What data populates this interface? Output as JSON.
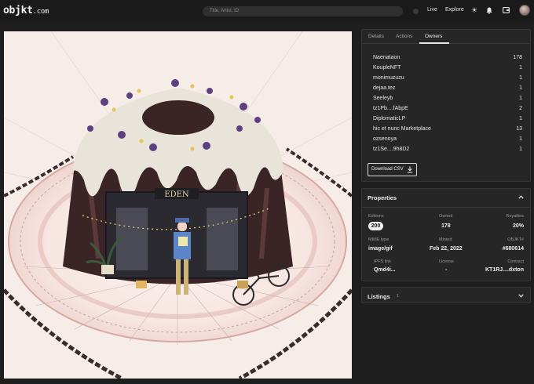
{
  "header": {
    "logo_main": "objkt",
    "logo_suffix": ".com",
    "search_placeholder": "Title, Artist, ID",
    "nav_live": "Live",
    "nav_explore": "Explore",
    "icons": [
      "sun-icon",
      "bell-icon",
      "wallet-icon",
      "avatar"
    ]
  },
  "tabs": [
    "Details",
    "Actions",
    "Owners"
  ],
  "active_tab": "Owners",
  "owners": [
    {
      "name": "Naenataon",
      "count": "178"
    },
    {
      "name": "KoupleNFT",
      "count": "1"
    },
    {
      "name": "monimuzuzu",
      "count": "1"
    },
    {
      "name": "dejaa.tez",
      "count": "1"
    },
    {
      "name": "Seeleyb",
      "count": "1"
    },
    {
      "name": "tz1Pb....fAbpE",
      "count": "2"
    },
    {
      "name": "DiplomaticLP",
      "count": "1"
    },
    {
      "name": "hic et nunc Marketplace",
      "count": "13"
    },
    {
      "name": "ozsenoya",
      "count": "1"
    },
    {
      "name": "tz1Se....9h8D2",
      "count": "1"
    }
  ],
  "download_csv": "Download CSV",
  "properties": {
    "title": "Properties",
    "editions_label": "Editions",
    "editions_value": "200",
    "owned_label": "Owned",
    "owned_value": "178",
    "royalties_label": "Royalties",
    "royalties_value": "20%",
    "mime_label": "MIME type",
    "mime_value": "image/gif",
    "minted_label": "Minted",
    "minted_value": "Feb 22, 2022",
    "objkt_label": "OBJKT#",
    "objkt_value": "#680614",
    "ipfs_label": "IPFS link",
    "ipfs_value": "Qmd4i...",
    "license_label": "License",
    "license_value": "-",
    "contract_label": "Contract",
    "contract_value": "KT1RJ....dxton"
  },
  "listings": {
    "title": "Listings",
    "count": "1"
  },
  "artwork": {
    "sign_text": "EDEN"
  }
}
